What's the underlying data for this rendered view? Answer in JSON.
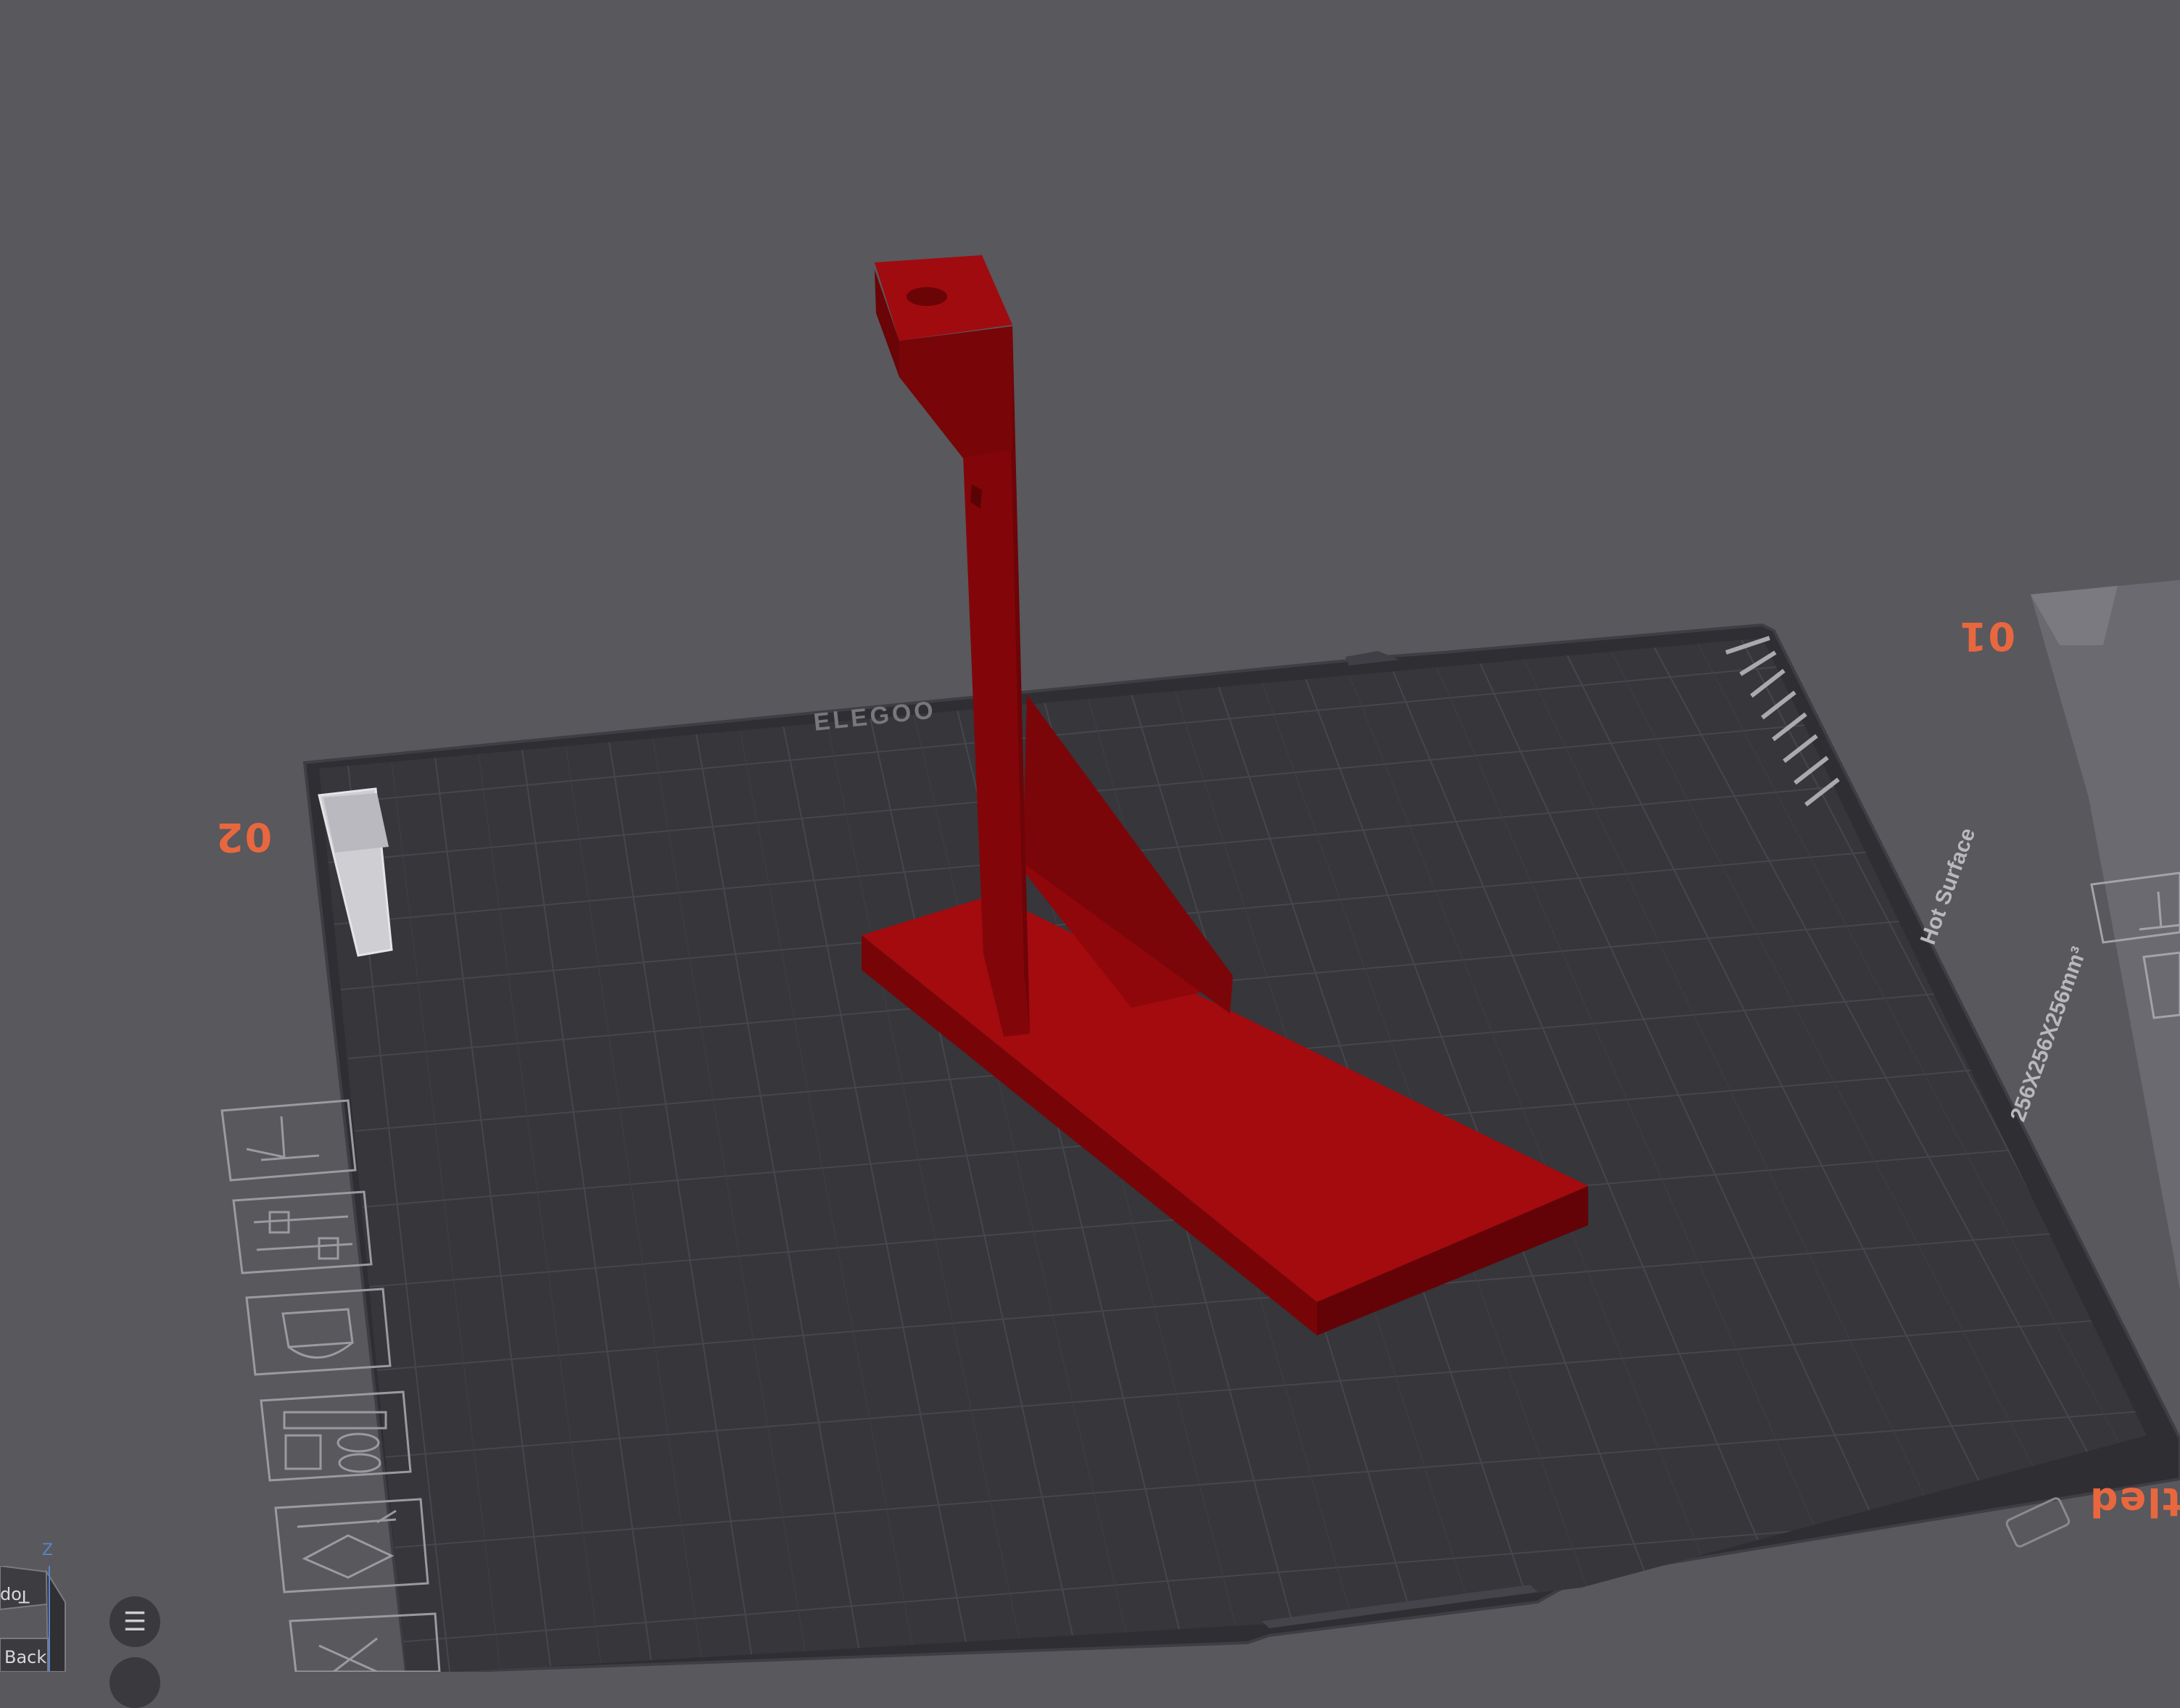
{
  "viewport": {
    "plate_labels": {
      "plate_02": "02",
      "plate_01": "01",
      "plate_untitled": "tled"
    },
    "bed": {
      "brand": "ELEGOO",
      "size_text": "256X256X256mm³",
      "surface_text": "Hot Surface"
    },
    "navigation_cube": {
      "top_label": "Top",
      "back_label": "Back",
      "axis_z": "Z"
    },
    "menu_icon": "☰"
  },
  "colors": {
    "background": "#58585d",
    "bed": "#36363b",
    "grid": "#47474d",
    "model_top": "#a30b0f",
    "model_side": "#820609",
    "model_dark": "#640307",
    "accent": "#e9673e"
  },
  "icons": [
    "place-on-face-icon",
    "settings-sliders-icon",
    "support-paint-icon",
    "arrange-icon",
    "auto-orient-icon",
    "delete-icon",
    "lock-icon"
  ]
}
